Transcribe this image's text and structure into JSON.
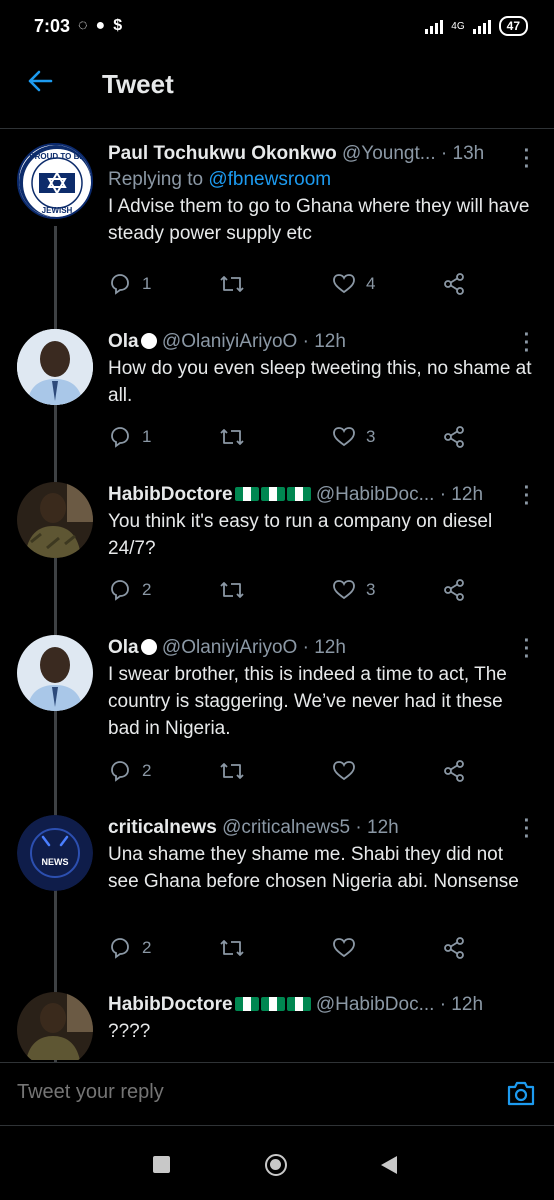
{
  "status": {
    "time": "7:03",
    "network": "4G",
    "battery": "47"
  },
  "header": {
    "title": "Tweet"
  },
  "tweets": [
    {
      "name": "Paul Tochukwu Okonkwo",
      "handle": "@Youngt...",
      "time": "· 13h",
      "replying_prefix": "Replying to ",
      "replying_to": "@fbnewsroom",
      "text": "I Advise them to go to Ghana where they will have steady power supply etc",
      "replies": "1",
      "retweets": "",
      "likes": "4",
      "avatar_label": "PROUD TO BE JEWISH"
    },
    {
      "name": "Ola",
      "handle": "@OlaniyiAriyoO",
      "time": "· 12h",
      "text": "How do you even sleep tweeting this, no shame at all.",
      "replies": "1",
      "retweets": "",
      "likes": "3"
    },
    {
      "name": "HabibDoctore",
      "handle": "@HabibDoc...",
      "time": "· 12h",
      "text": "You think it's easy to run a company on diesel 24/7?",
      "replies": "2",
      "retweets": "",
      "likes": "3"
    },
    {
      "name": "Ola",
      "handle": "@OlaniyiAriyoO",
      "time": "· 12h",
      "text": "I swear brother, this is indeed a time to act, The country is staggering. We’ve never had it these bad in Nigeria.",
      "replies": "2",
      "retweets": "",
      "likes": ""
    },
    {
      "name": "criticalnews",
      "handle": "@criticalnews5",
      "time": "· 12h",
      "text": "Una shame they shame me. Shabi they did not see Ghana before chosen Nigeria abi. Nonsense",
      "replies": "2",
      "retweets": "",
      "likes": "",
      "avatar_label": "NEWS"
    },
    {
      "name": "HabibDoctore",
      "handle": "@HabibDoc...",
      "time": "· 12h",
      "text": "????"
    }
  ],
  "reply": {
    "placeholder": "Tweet your reply"
  },
  "icons": {
    "back": "arrow-left-icon",
    "more": "more-vertical-icon",
    "reply": "reply-icon",
    "retweet": "retweet-icon",
    "like": "heart-icon",
    "share": "share-icon",
    "camera": "camera-icon",
    "flag": "nigeria-flag-icon",
    "circle": "white-circle-icon"
  },
  "colors": {
    "accent": "#1d9bf0",
    "muted": "#8b98a5",
    "background": "#000000",
    "flag_green": "#008751"
  }
}
